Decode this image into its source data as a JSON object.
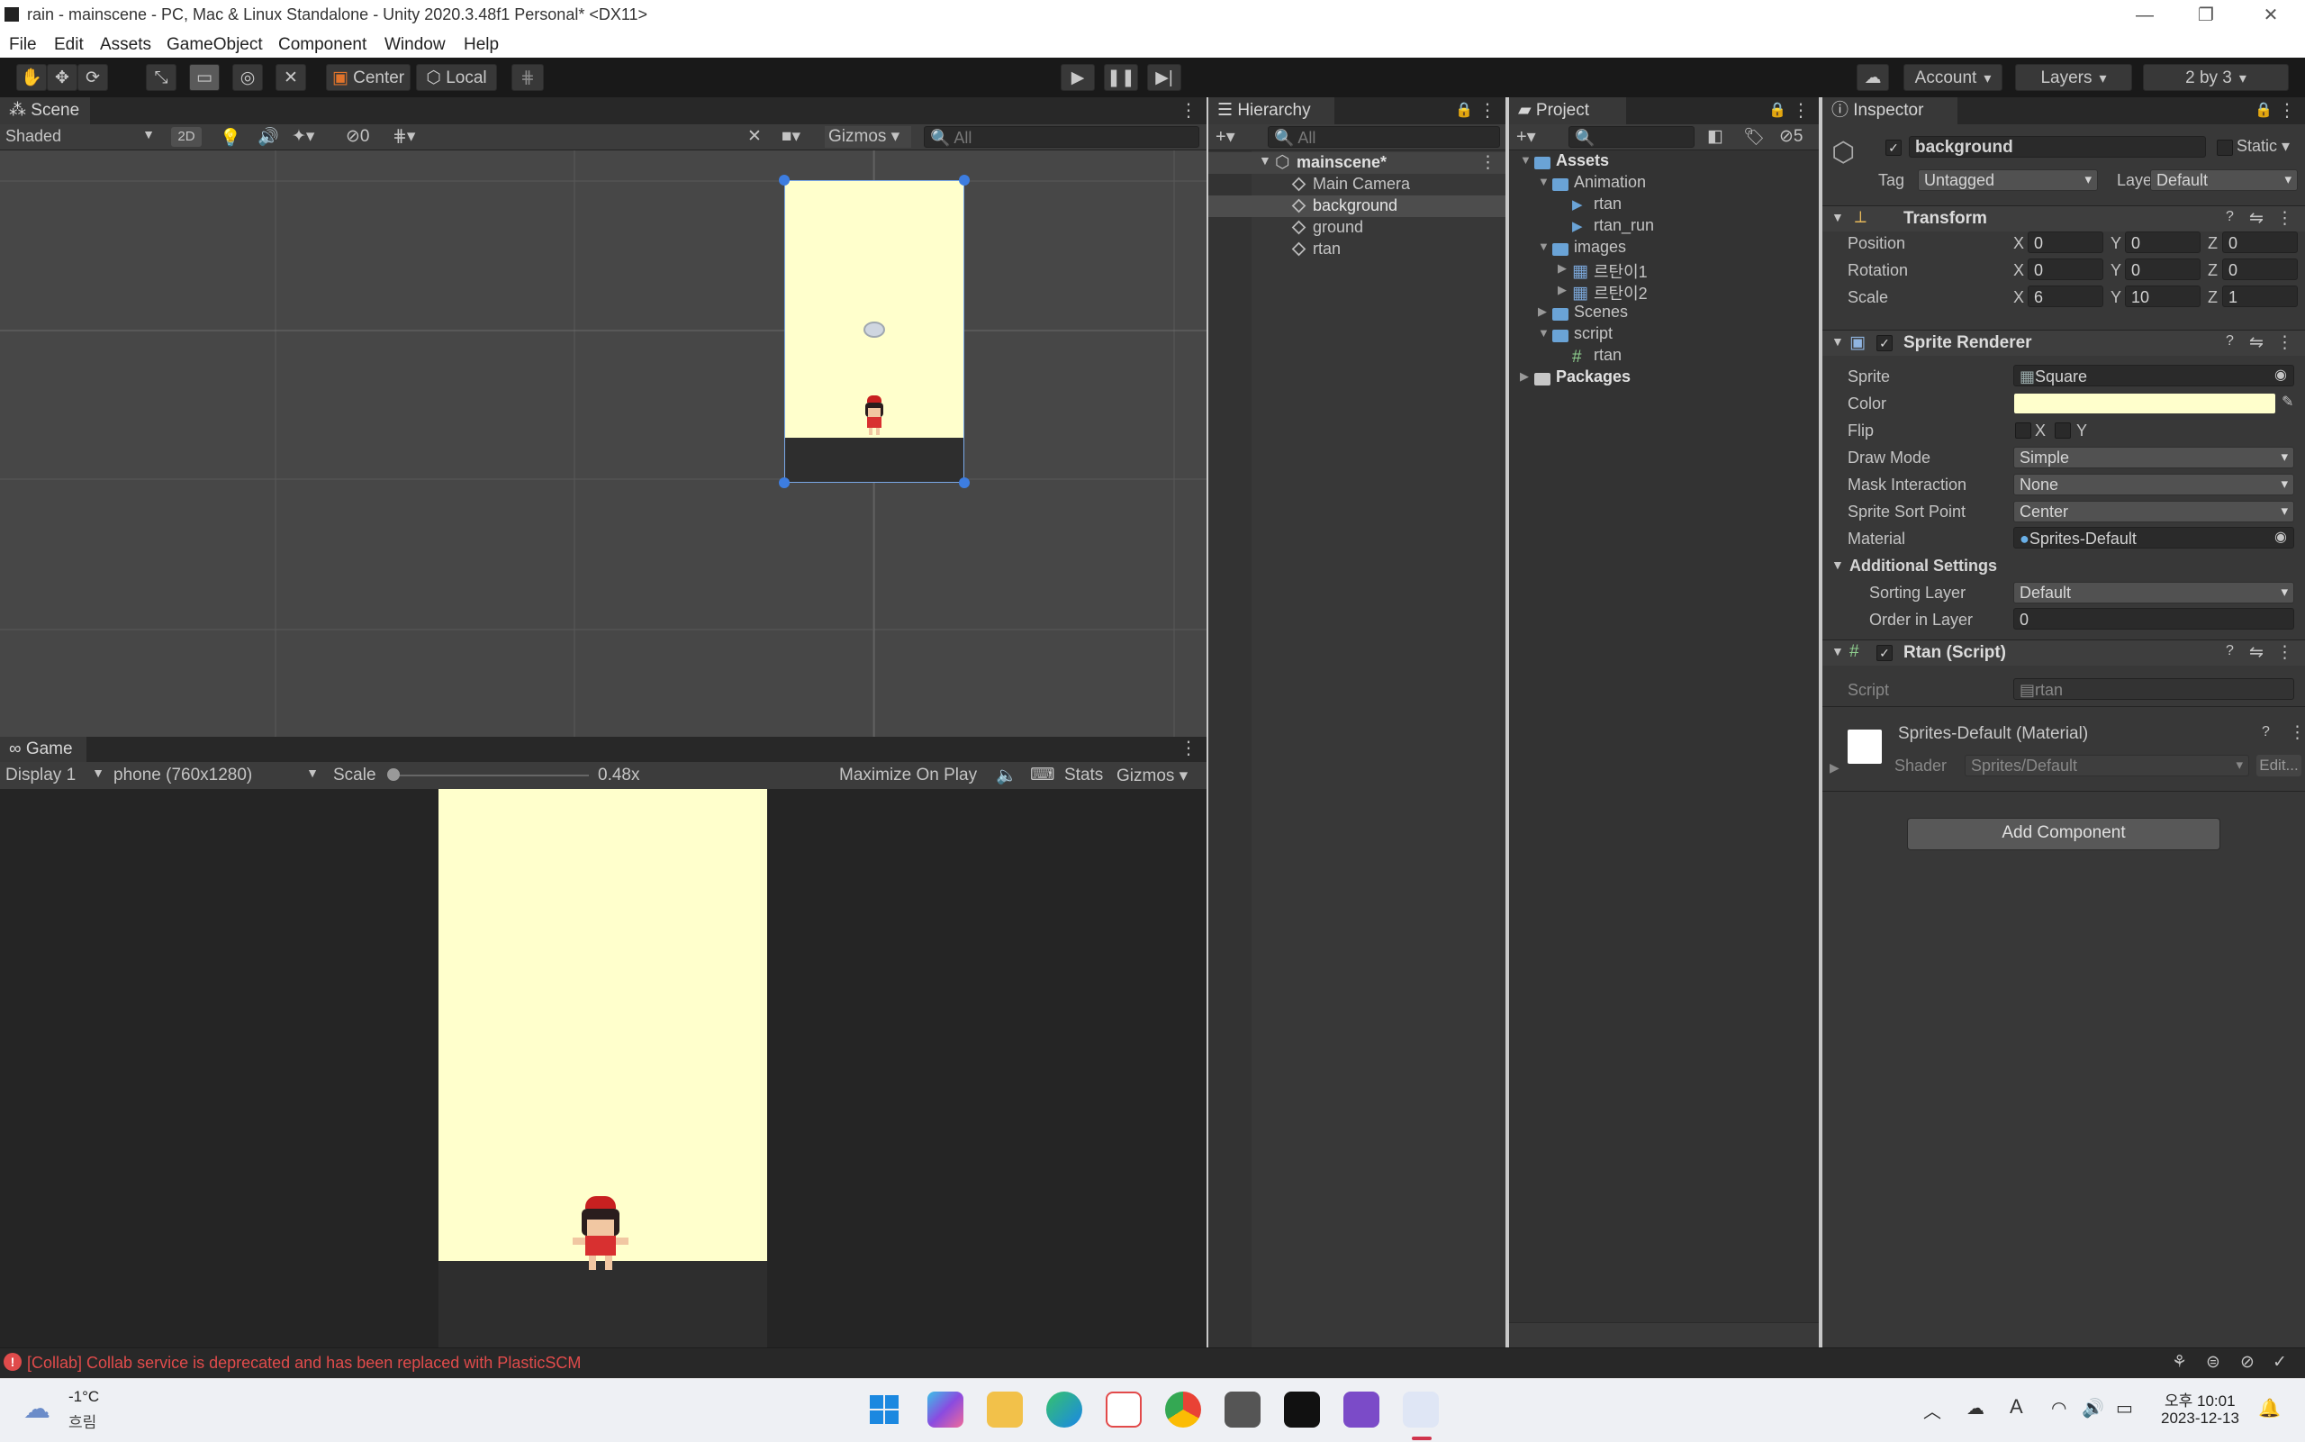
{
  "window": {
    "title": "rain - mainscene - PC, Mac & Linux Standalone - Unity 2020.3.48f1 Personal* <DX11>"
  },
  "menu": [
    "File",
    "Edit",
    "Assets",
    "GameObject",
    "Component",
    "Window",
    "Help"
  ],
  "toolbar": {
    "pivot": "Center",
    "space": "Local",
    "account": "Account",
    "layers": "Layers",
    "layout": "2 by 3"
  },
  "scene": {
    "tab": "Scene",
    "shading": "Shaded",
    "mode2d": "2D",
    "hidden_count": "0",
    "gizmos": "Gizmos",
    "search_placeholder": "All"
  },
  "game": {
    "tab": "Game",
    "display": "Display 1",
    "resolution": "phone (760x1280)",
    "scale_label": "Scale",
    "scale_value": "0.48x",
    "maximize": "Maximize On Play",
    "stats": "Stats",
    "gizmos": "Gizmos"
  },
  "hierarchy": {
    "tab": "Hierarchy",
    "search_placeholder": "All",
    "scene": "mainscene*",
    "items": [
      "Main Camera",
      "background",
      "ground",
      "rtan"
    ],
    "selected": "background"
  },
  "project": {
    "tab": "Project",
    "hidden_count": "5",
    "tree": [
      {
        "label": "Assets",
        "depth": 0,
        "kind": "folder",
        "expanded": true
      },
      {
        "label": "Animation",
        "depth": 1,
        "kind": "folder",
        "expanded": true
      },
      {
        "label": "rtan",
        "depth": 2,
        "kind": "anim"
      },
      {
        "label": "rtan_run",
        "depth": 2,
        "kind": "anim"
      },
      {
        "label": "images",
        "depth": 1,
        "kind": "folder",
        "expanded": true
      },
      {
        "label": "르탄이1",
        "depth": 2,
        "kind": "sprite"
      },
      {
        "label": "르탄이2",
        "depth": 2,
        "kind": "sprite"
      },
      {
        "label": "Scenes",
        "depth": 1,
        "kind": "folder",
        "expanded": false
      },
      {
        "label": "script",
        "depth": 1,
        "kind": "folder",
        "expanded": true
      },
      {
        "label": "rtan",
        "depth": 2,
        "kind": "script"
      },
      {
        "label": "Packages",
        "depth": 0,
        "kind": "folder",
        "expanded": false
      }
    ]
  },
  "inspector": {
    "tab": "Inspector",
    "object_name": "background",
    "static_label": "Static",
    "tag_label": "Tag",
    "tag_value": "Untagged",
    "layer_label": "Layer",
    "layer_value": "Default",
    "transform": {
      "title": "Transform",
      "rows": [
        {
          "label": "Position",
          "x": "0",
          "y": "0",
          "z": "0"
        },
        {
          "label": "Rotation",
          "x": "0",
          "y": "0",
          "z": "0"
        },
        {
          "label": "Scale",
          "x": "6",
          "y": "10",
          "z": "1"
        }
      ]
    },
    "sprite_renderer": {
      "title": "Sprite Renderer",
      "sprite_label": "Sprite",
      "sprite_value": "Square",
      "color_label": "Color",
      "color_value": "#FFFFCC",
      "flip_label": "Flip",
      "flip_x": "X",
      "flip_y": "Y",
      "draw_mode_label": "Draw Mode",
      "draw_mode_value": "Simple",
      "mask_label": "Mask Interaction",
      "mask_value": "None",
      "sort_point_label": "Sprite Sort Point",
      "sort_point_value": "Center",
      "material_label": "Material",
      "material_value": "Sprites-Default",
      "additional_title": "Additional Settings",
      "sorting_layer_label": "Sorting Layer",
      "sorting_layer_value": "Default",
      "order_label": "Order in Layer",
      "order_value": "0"
    },
    "script_comp": {
      "title": "Rtan (Script)",
      "script_label": "Script",
      "script_value": "rtan"
    },
    "material": {
      "title": "Sprites-Default (Material)",
      "shader_label": "Shader",
      "shader_value": "Sprites/Default",
      "edit": "Edit..."
    },
    "add_component": "Add Component"
  },
  "status": {
    "message": "[Collab] Collab service is deprecated and has been replaced with PlasticSCM"
  },
  "taskbar": {
    "temperature": "-1°C",
    "weather": "흐림",
    "time": "오후 10:01",
    "date": "2023-12-13"
  },
  "colors": {
    "background_sprite": "#FFFFCC",
    "accent": "#2c5d87",
    "error": "#e04b4b"
  }
}
